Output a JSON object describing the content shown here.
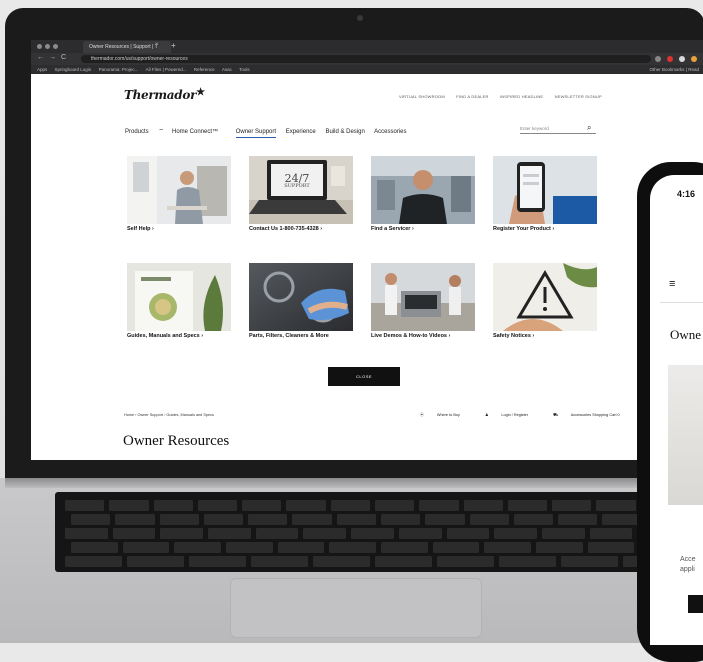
{
  "browser": {
    "tab_title": "Owner Resources | Support | T",
    "tab_close": "×",
    "new_tab": "+",
    "back": "←",
    "forward": "→",
    "reload": "C",
    "url": "thermador.com/us/support/owner-resources",
    "bookmarks": [
      "Apps",
      "Springboard Login",
      "Panorama: Projec...",
      "All Files | Powered...",
      "Reference",
      "Asac",
      "Tools"
    ],
    "bookmarks_right": "Other Bookmarks",
    "reading_list": "Read"
  },
  "site": {
    "logo": "Thermador",
    "logo_star": "★",
    "utility_links": [
      "VIRTUAL SHOWROOM",
      "FIND A DEALER",
      "INSPIRED HEADLINE",
      "NEWSLETTER SIGNUP"
    ],
    "nav": [
      "Products",
      "Home Connect™",
      "Owner Support",
      "Experience",
      "Build & Design",
      "Accessories"
    ],
    "nav_active": "Owner Support",
    "search_placeholder": "Enter keyword",
    "tiles": [
      {
        "label": "Self Help ›",
        "art": "kitchen-woman"
      },
      {
        "label": "Contact Us 1-800-735-4328 ›",
        "art": "laptop-support"
      },
      {
        "label": "Find a Servicer ›",
        "art": "technician"
      },
      {
        "label": "Register Your Product ›",
        "art": "phone-hand"
      },
      {
        "label": "Guides, Manuals and Specs ›",
        "art": "guide-book"
      },
      {
        "label": "Parts, Filters, Cleaners & More",
        "art": "cooktop-cleaning"
      },
      {
        "label": "Live Demos & How-to Videos ›",
        "art": "demo-kitchen"
      },
      {
        "label": "Safety Notices ›",
        "art": "warning-sign"
      }
    ],
    "support_badge_line1": "24/7",
    "support_badge_line2": "SUPPORT",
    "close_button": "CLOSE",
    "breadcrumb": "Home  ›  Owner Support  ›  Guides, Manuals and Specs",
    "util_row": [
      "Where to Buy",
      "Login / Register",
      "Accessories Shopping Cart 0"
    ],
    "page_heading": "Owner Resources"
  },
  "phone": {
    "time": "4:16",
    "menu_icon": "≡",
    "title": "Owne",
    "text_line1": "Acce",
    "text_line2": "appli"
  }
}
